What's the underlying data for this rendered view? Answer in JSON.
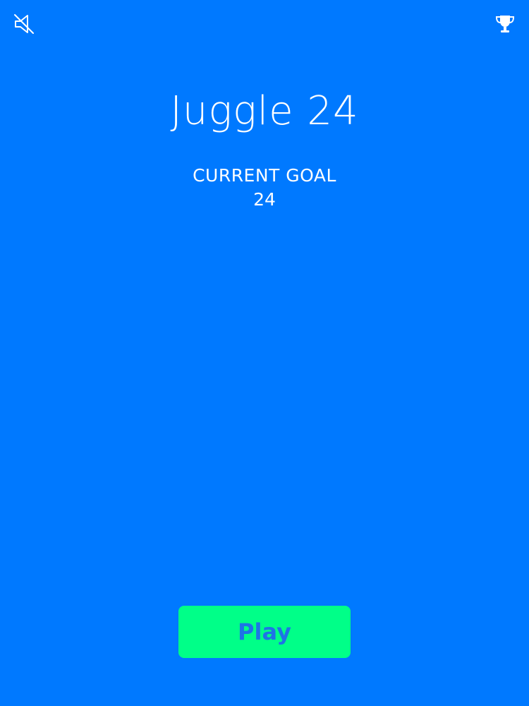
{
  "app": {
    "background_color": "#0079FF",
    "accent_color": "#00FF88"
  },
  "toolbar": {
    "sound_icon": "sound-muted-icon",
    "trophy_icon": "trophy-icon"
  },
  "main": {
    "title": "Juggle 24",
    "goal_label": "CURRENT GOAL",
    "goal_value": "24"
  },
  "actions": {
    "play_label": "Play"
  }
}
